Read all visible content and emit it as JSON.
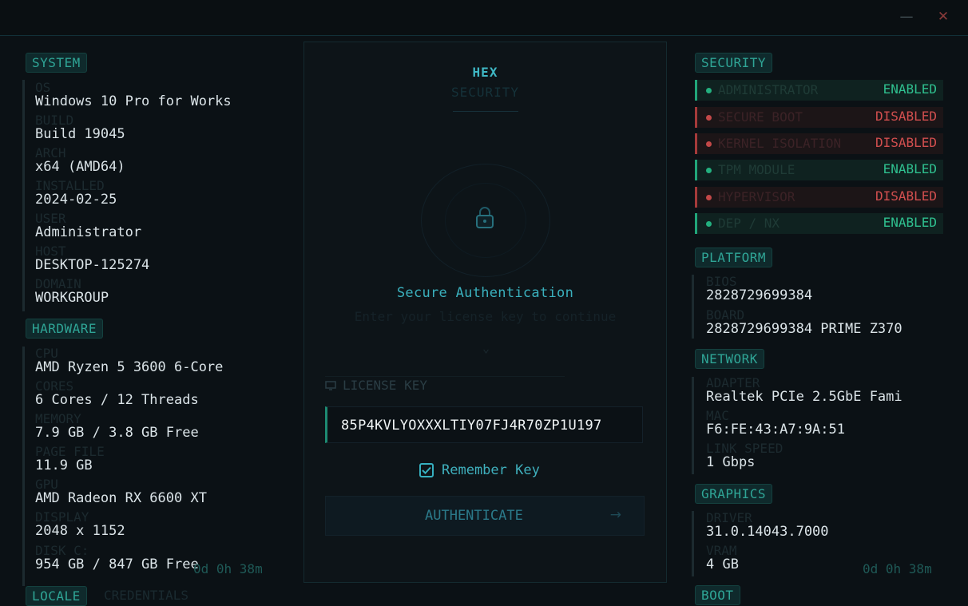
{
  "window": {
    "minimize_icon": "minimize-icon",
    "close_icon": "close-icon"
  },
  "system": {
    "heading": "SYSTEM",
    "fields": [
      {
        "label": "OS",
        "value": "Windows 10 Pro for Works"
      },
      {
        "label": "BUILD",
        "value": "Build 19045"
      },
      {
        "label": "ARCH",
        "value": "x64 (AMD64)"
      },
      {
        "label": "INSTALLED",
        "value": "2024-02-25"
      },
      {
        "label": "USER",
        "value": "Administrator"
      },
      {
        "label": "HOST",
        "value": "DESKTOP-125274"
      },
      {
        "label": "DOMAIN",
        "value": "WORKGROUP"
      }
    ]
  },
  "hardware": {
    "heading": "HARDWARE",
    "fields": [
      {
        "label": "CPU",
        "value": "AMD Ryzen 5 3600 6-Core"
      },
      {
        "label": "CORES",
        "value": "6 Cores / 12 Threads"
      },
      {
        "label": "MEMORY",
        "value": "7.9 GB / 3.8 GB Free"
      },
      {
        "label": "PAGE FILE",
        "value": "11.9 GB"
      },
      {
        "label": "GPU",
        "value": "AMD Radeon RX 6600 XT"
      },
      {
        "label": "DISPLAY",
        "value": "2048 x 1152"
      },
      {
        "label": "DISK C:",
        "value": "954 GB / 847 GB Free"
      }
    ]
  },
  "left_uptime": "0d 0h 38m",
  "left_bottom": {
    "locale": "LOCALE",
    "credentials": "CREDENTIALS"
  },
  "security": {
    "heading": "SECURITY",
    "rows": [
      {
        "name": "ADMINISTRATOR",
        "state": "ENABLED"
      },
      {
        "name": "SECURE BOOT",
        "state": "DISABLED"
      },
      {
        "name": "KERNEL ISOLATION",
        "state": "DISABLED"
      },
      {
        "name": "TPM MODULE",
        "state": "ENABLED"
      },
      {
        "name": "HYPERVISOR",
        "state": "DISABLED"
      },
      {
        "name": "DEP / NX",
        "state": "ENABLED"
      }
    ]
  },
  "platform": {
    "heading": "PLATFORM",
    "fields": [
      {
        "label": "BIOS",
        "value": "2828729699384"
      },
      {
        "label": "BOARD",
        "value": "2828729699384 PRIME Z370"
      }
    ]
  },
  "network": {
    "heading": "NETWORK",
    "fields": [
      {
        "label": "ADAPTER",
        "value": "Realtek PCIe 2.5GbE Fami"
      },
      {
        "label": "MAC",
        "value": "F6:FE:43:A7:9A:51"
      },
      {
        "label": "LINK SPEED",
        "value": "1 Gbps"
      }
    ]
  },
  "graphics": {
    "heading": "GRAPHICS",
    "fields": [
      {
        "label": "DRIVER",
        "value": "31.0.14043.7000"
      },
      {
        "label": "VRAM",
        "value": "4 GB"
      }
    ]
  },
  "boot": {
    "heading": "BOOT"
  },
  "right_uptime": "0d 0h 38m",
  "auth": {
    "logo_title": "HEX",
    "logo_subtitle": "SECURITY",
    "title": "Secure Authentication",
    "subtitle": "Enter your license key to continue",
    "license_label": "LICENSE KEY",
    "license_value": "85P4KVLYOXXXLTIY07FJ4R70ZP1U197",
    "remember_label": "Remember Key",
    "remember_checked": true,
    "button_label": "AUTHENTICATE",
    "button_arrow": "→"
  },
  "colors": {
    "accent": "#3ab0bd",
    "enabled": "#2fc08f",
    "disabled": "#d24f4f"
  }
}
